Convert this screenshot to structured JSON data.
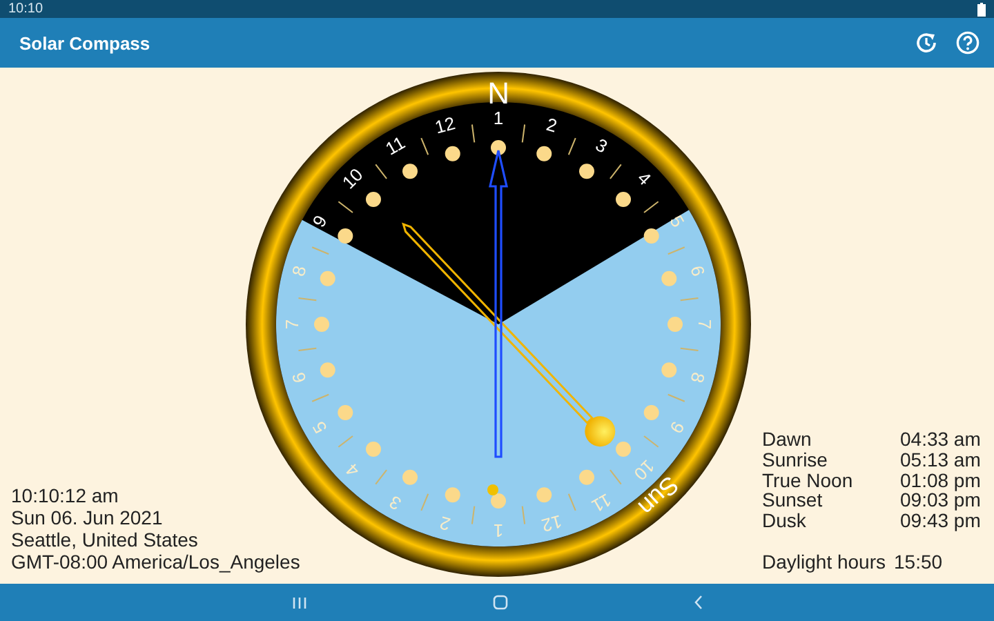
{
  "status_bar": {
    "time": "10:10"
  },
  "app_bar": {
    "title": "Solar Compass"
  },
  "compass": {
    "north_label": "N",
    "sun_label": "Sun",
    "hour_labels": [
      "1",
      "2",
      "3",
      "4",
      "5",
      "6",
      "7",
      "8",
      "9",
      "10",
      "11",
      "12",
      "1",
      "2",
      "3",
      "4",
      "5",
      "6",
      "7",
      "8",
      "9",
      "10",
      "11",
      "12"
    ]
  },
  "location_info": [
    "10:10:12 am",
    "Sun 06. Jun 2021",
    "Seattle, United States",
    "GMT-08:00 America/Los_Angeles"
  ],
  "sun_times": [
    {
      "event": "Dawn",
      "time": "04:33 am"
    },
    {
      "event": "Sunrise",
      "time": "05:13 am"
    },
    {
      "event": "True Noon",
      "time": "01:08 pm"
    },
    {
      "event": "Sunset",
      "time": "09:03 pm"
    },
    {
      "event": "Dusk",
      "time": "09:43 pm"
    }
  ],
  "daylight": {
    "label": "Daylight hours",
    "value": "15:50"
  }
}
